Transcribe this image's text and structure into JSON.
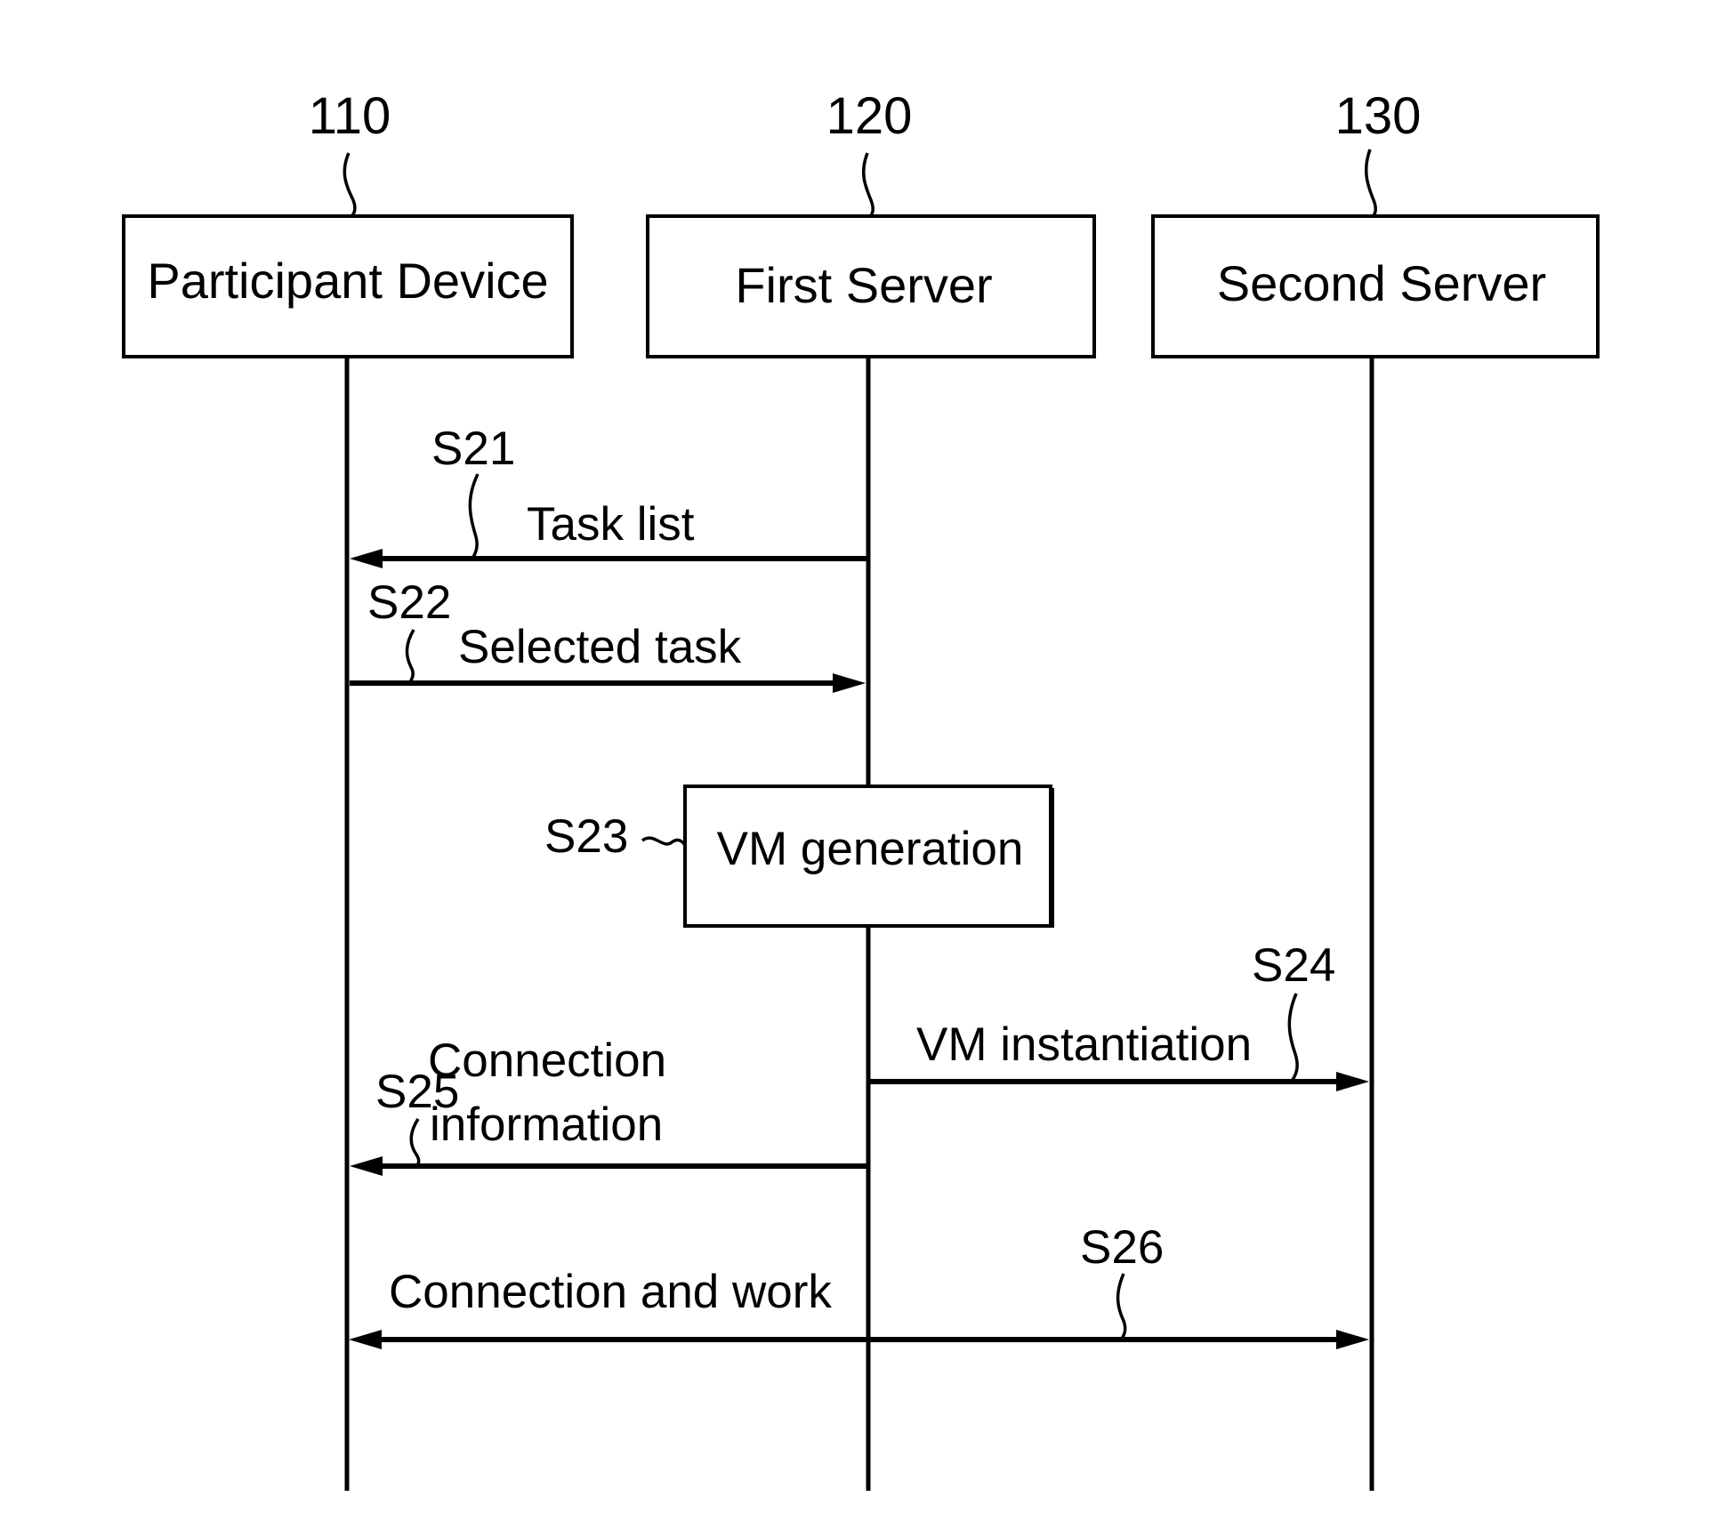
{
  "diagram": {
    "type": "sequence-diagram",
    "participants": [
      {
        "id": "participant-device",
        "ref": "110",
        "label": "Participant Device"
      },
      {
        "id": "first-server",
        "ref": "120",
        "label": "First Server"
      },
      {
        "id": "second-server",
        "ref": "130",
        "label": "Second Server"
      }
    ],
    "steps": [
      {
        "step": "S21",
        "label": "Task list",
        "from": "first-server",
        "to": "participant-device",
        "kind": "message"
      },
      {
        "step": "S22",
        "label": "Selected task",
        "from": "participant-device",
        "to": "first-server",
        "kind": "message"
      },
      {
        "step": "S23",
        "label": "VM generation",
        "at": "first-server",
        "kind": "process"
      },
      {
        "step": "S24",
        "label": "VM instantiation",
        "from": "first-server",
        "to": "second-server",
        "kind": "message"
      },
      {
        "step": "S25",
        "label_lines": [
          "Connection",
          "information"
        ],
        "from": "first-server",
        "to": "participant-device",
        "kind": "message"
      },
      {
        "step": "S26",
        "label": "Connection and work",
        "from": "participant-device",
        "to": "second-server",
        "kind": "bidirectional"
      }
    ]
  }
}
